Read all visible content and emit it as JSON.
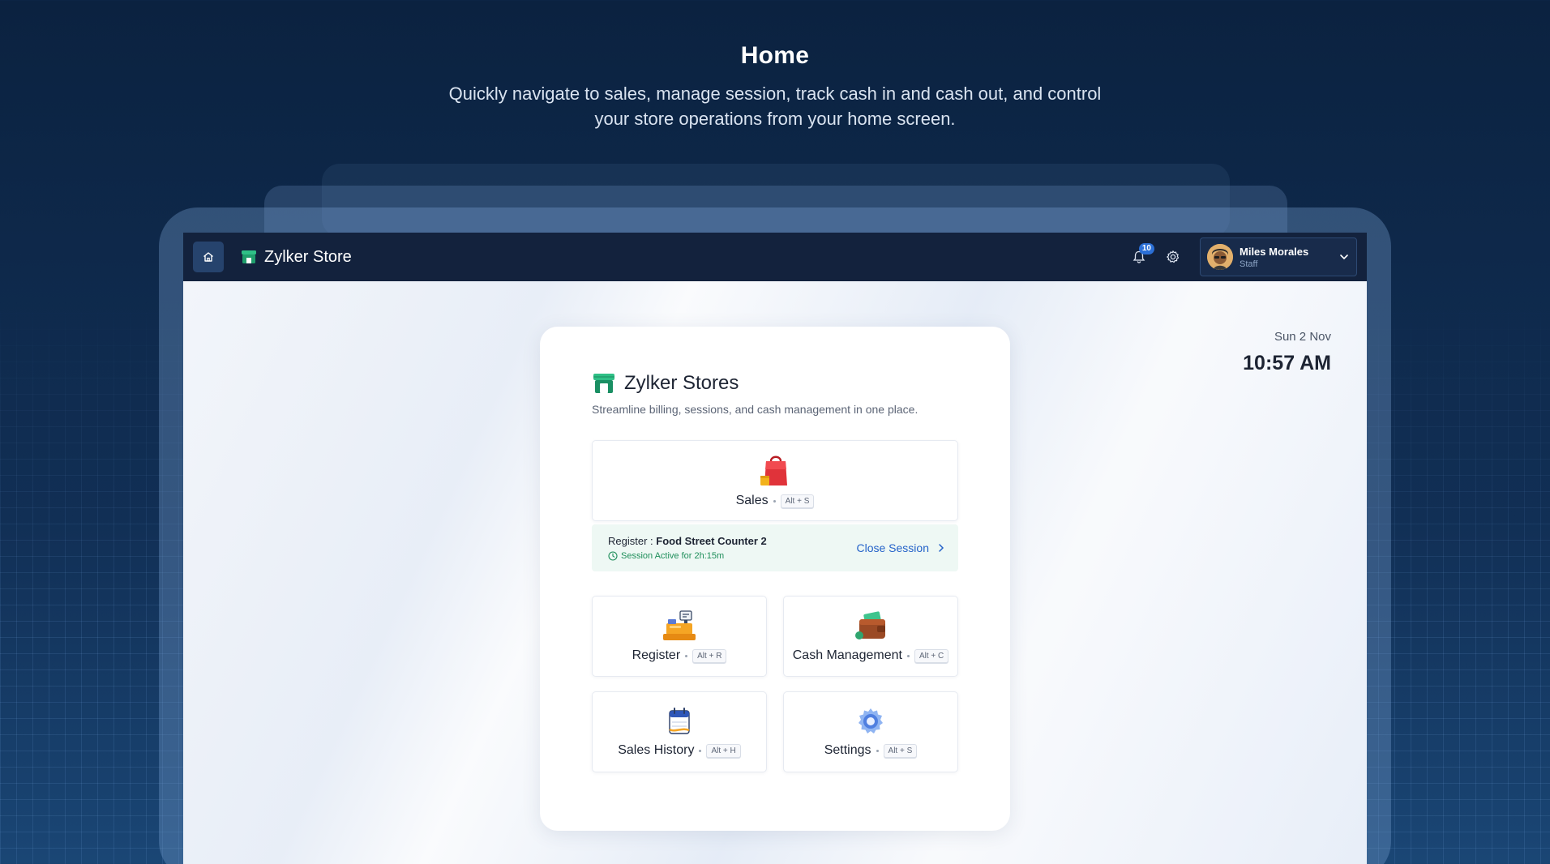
{
  "hero": {
    "title": "Home",
    "subtitle": "Quickly navigate to sales, manage session, track cash in and cash out, and control your store operations from your home screen."
  },
  "topbar": {
    "brand": "Zylker Store",
    "notifications_count": "10",
    "user": {
      "name": "Miles Morales",
      "role": "Staff"
    }
  },
  "datetime": {
    "date": "Sun 2 Nov",
    "time": "10:57 AM"
  },
  "card": {
    "title": "Zylker Stores",
    "subtitle": "Streamline billing, sessions, and cash management in one place."
  },
  "sales": {
    "label": "Sales",
    "shortcut": "Alt + S"
  },
  "session": {
    "register_prefix": "Register : ",
    "register_name": "Food Street Counter 2",
    "status": "Session Active for 2h:15m",
    "close_label": "Close Session"
  },
  "tiles": [
    {
      "label": "Register",
      "shortcut": "Alt + R"
    },
    {
      "label": "Cash Management",
      "shortcut": "Alt + C"
    },
    {
      "label": "Sales History",
      "shortcut": "Alt + H"
    },
    {
      "label": "Settings",
      "shortcut": "Alt + S"
    }
  ],
  "colors": {
    "topbar": "#13223d",
    "accent_green": "#1e8e5a",
    "link_blue": "#2563c9"
  }
}
